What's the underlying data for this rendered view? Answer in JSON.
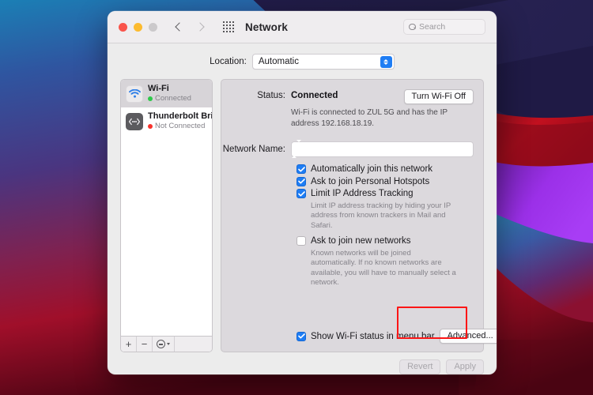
{
  "window": {
    "title": "Network",
    "traffic_lights": [
      "close",
      "minimize",
      "zoom"
    ],
    "nav_back_icon": "chevron-left-icon",
    "nav_forward_icon": "chevron-right-icon",
    "grid_icon": "grid-apps-icon",
    "search": {
      "placeholder": "Search",
      "icon": "search-icon",
      "value": ""
    }
  },
  "location": {
    "label": "Location:",
    "selected": "Automatic",
    "options": [
      "Automatic"
    ]
  },
  "sidebar": {
    "services": [
      {
        "name": "Wi-Fi",
        "status": "Connected",
        "status_color": "#2ec84a",
        "icon": "wifi-icon",
        "selected": true
      },
      {
        "name": "Thunderbolt Bridge",
        "status": "Not Connected",
        "status_color": "#f8322c",
        "icon": "thunderbolt-bridge-icon",
        "selected": false
      }
    ],
    "toolbar": {
      "add_label": "+",
      "remove_label": "−",
      "actions_icon": "gear-icon"
    }
  },
  "detail": {
    "status_label": "Status:",
    "status_value": "Connected",
    "turn_off_button": "Turn Wi-Fi Off",
    "status_description": "Wi-Fi is connected to ZUL 5G and has the IP address 192.168.18.19.",
    "network_name_label": "Network Name:",
    "network_name_value": "",
    "checkboxes": [
      {
        "label": "Automatically join this network",
        "checked": true,
        "note": ""
      },
      {
        "label": "Ask to join Personal Hotspots",
        "checked": true,
        "note": ""
      },
      {
        "label": "Limit IP Address Tracking",
        "checked": true,
        "note": "Limit IP address tracking by hiding your IP address from known trackers in Mail and Safari."
      },
      {
        "label": "Ask to join new networks",
        "checked": false,
        "note": "Known networks will be joined automatically. If no known networks are available, you will have to manually select a network."
      }
    ],
    "show_status_checkbox": {
      "label": "Show Wi-Fi status in menu bar",
      "checked": true
    },
    "advanced_button": "Advanced...",
    "help_button": "?"
  },
  "footer": {
    "revert_button": "Revert",
    "apply_button": "Apply"
  },
  "annotation": {
    "highlight_color": "#fc1616",
    "target": "advanced-button"
  }
}
